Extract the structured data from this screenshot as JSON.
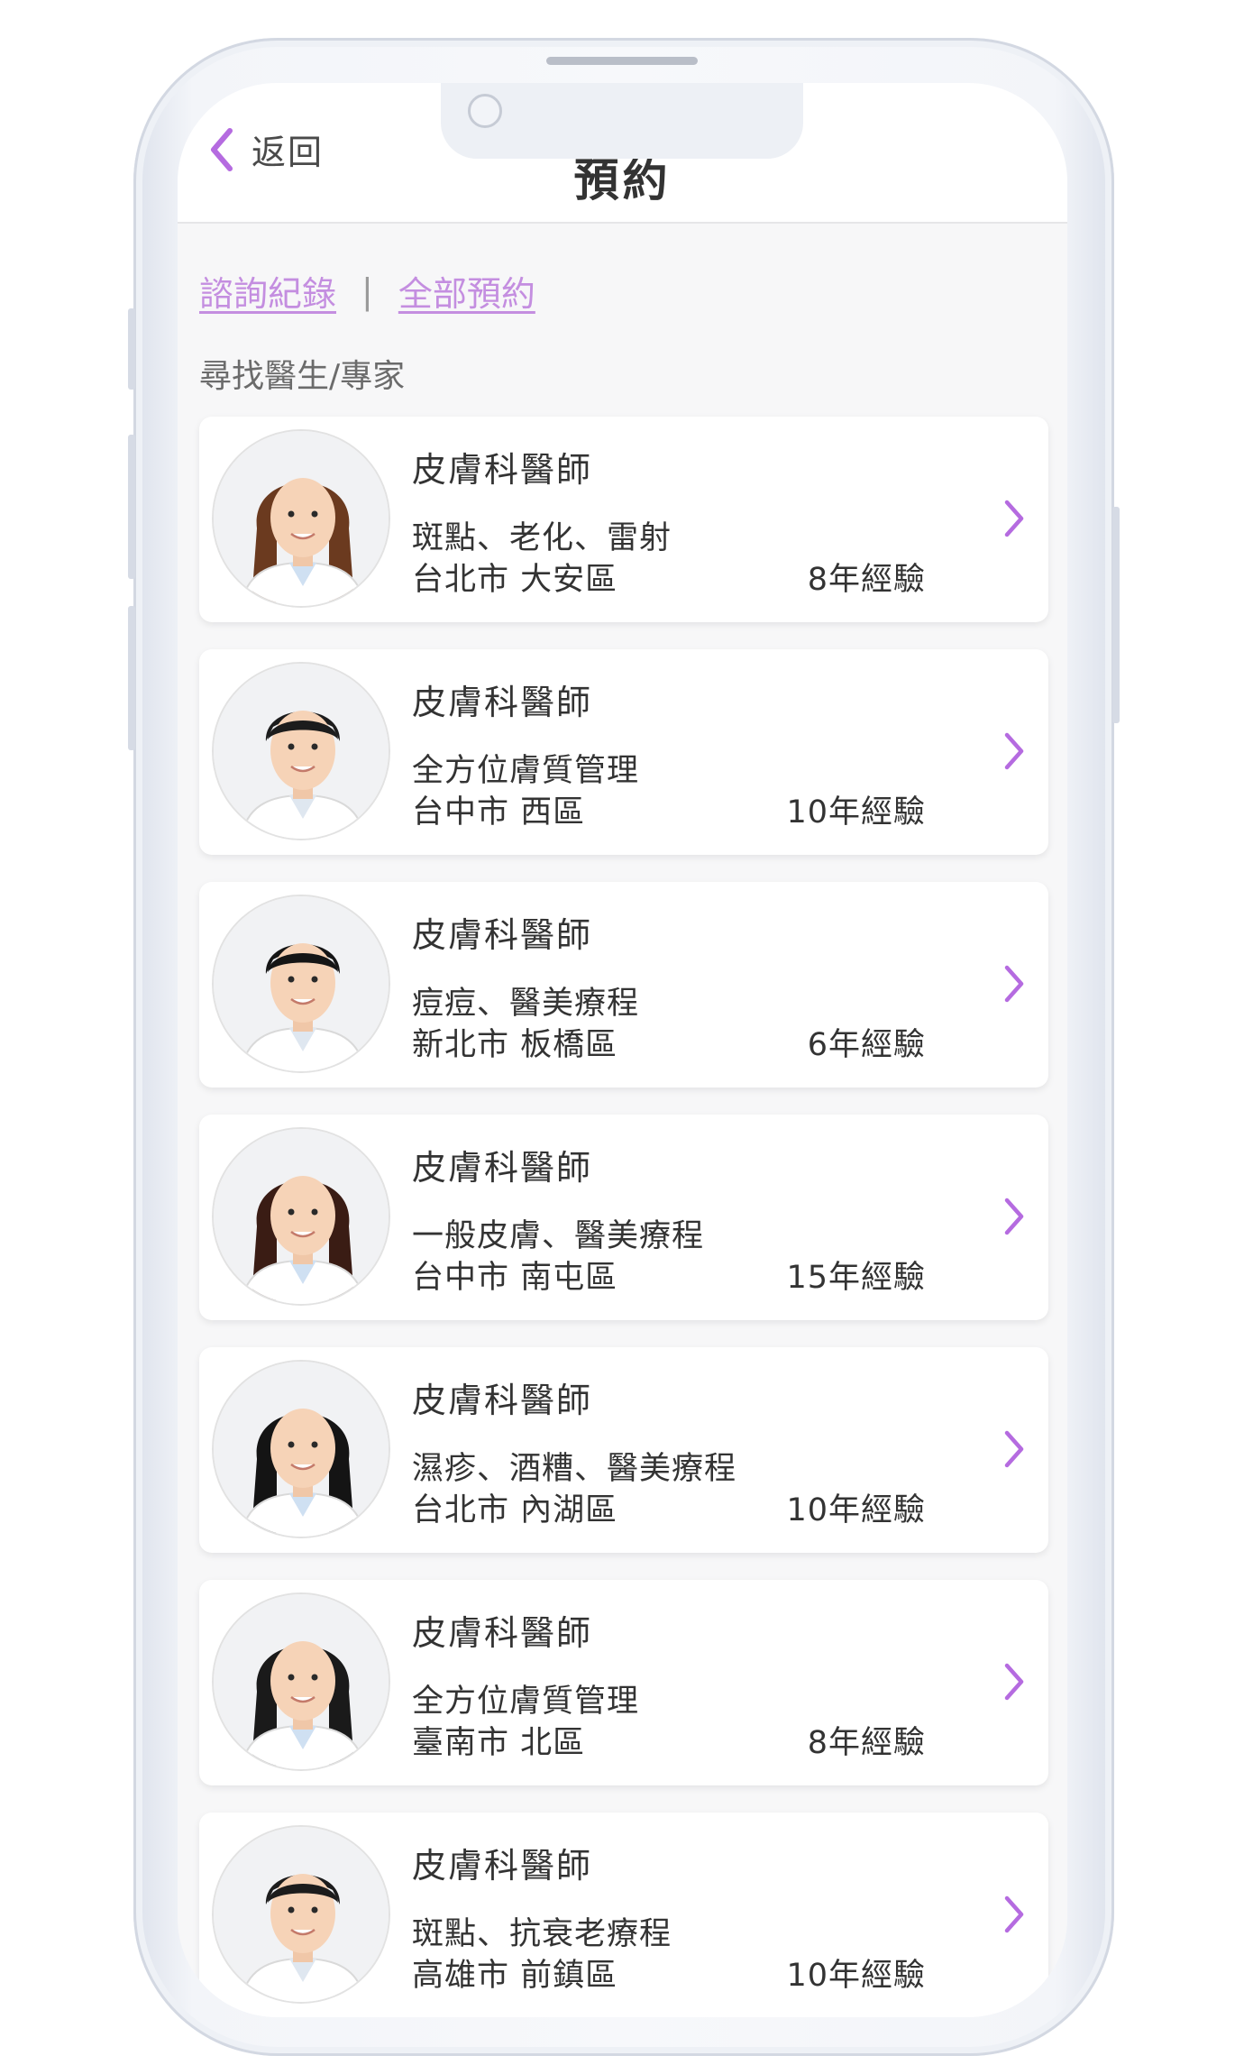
{
  "header": {
    "back_label": "返回",
    "title": "預約"
  },
  "links": {
    "history": "諮詢紀錄",
    "separator": "|",
    "all": "全部預約"
  },
  "section_title": "尋找醫生/專家",
  "colors": {
    "accent": "#b56be0",
    "link": "#c48ee0"
  },
  "doctors": [
    {
      "title": "皮膚科醫師",
      "specialty": "斑點、老化、雷射",
      "location": "台北市 大安區",
      "experience": "8年經驗",
      "gender": "female"
    },
    {
      "title": "皮膚科醫師",
      "specialty": "全方位膚質管理",
      "location": "台中市 西區",
      "experience": "10年經驗",
      "gender": "male"
    },
    {
      "title": "皮膚科醫師",
      "specialty": "痘痘、醫美療程",
      "location": "新北市 板橋區",
      "experience": "6年經驗",
      "gender": "male"
    },
    {
      "title": "皮膚科醫師",
      "specialty": "一般皮膚、醫美療程",
      "location": "台中市 南屯區",
      "experience": "15年經驗",
      "gender": "female"
    },
    {
      "title": "皮膚科醫師",
      "specialty": "濕疹、酒糟、醫美療程",
      "location": "台北市 內湖區",
      "experience": "10年經驗",
      "gender": "female"
    },
    {
      "title": "皮膚科醫師",
      "specialty": "全方位膚質管理",
      "location": "臺南市 北區",
      "experience": "8年經驗",
      "gender": "female"
    },
    {
      "title": "皮膚科醫師",
      "specialty": "斑點、抗衰老療程",
      "location": "高雄市 前鎮區",
      "experience": "10年經驗",
      "gender": "male"
    }
  ]
}
